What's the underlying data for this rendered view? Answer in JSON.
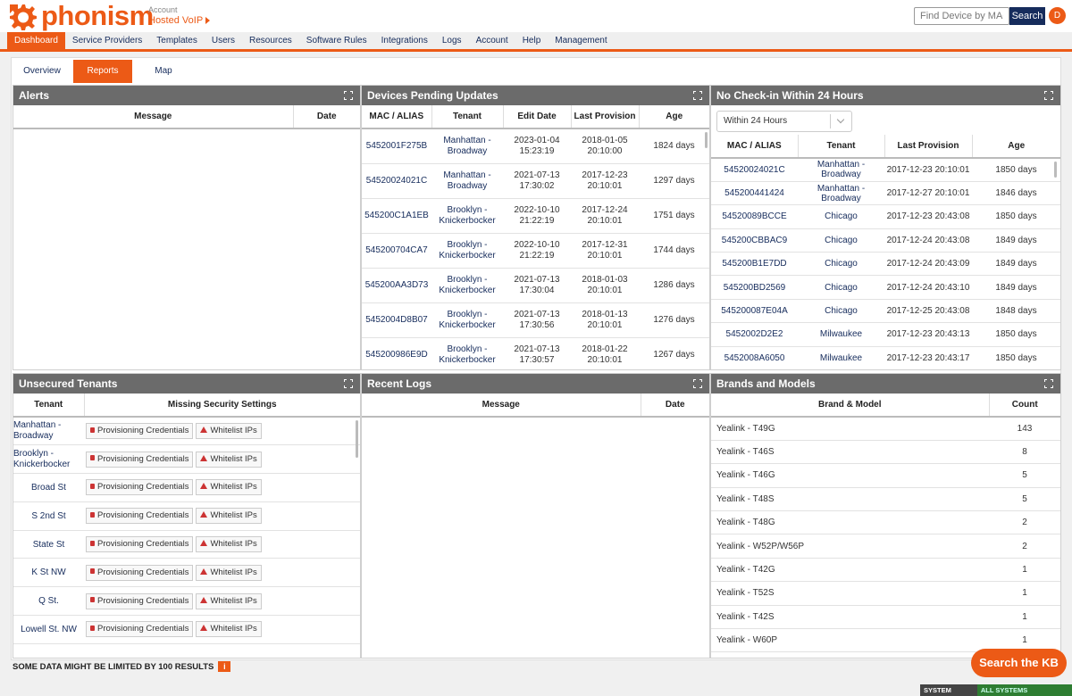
{
  "header": {
    "logo_text": "phonism",
    "account_label": "Account",
    "account_name": "Hosted VoIP",
    "search_placeholder": "Find Device by MAC",
    "search_button": "Search",
    "avatar_initial": "D",
    "brand_color": "#ec5a16",
    "navy_color": "#162c5c"
  },
  "nav": [
    {
      "label": "Dashboard",
      "active": true
    },
    {
      "label": "Service Providers"
    },
    {
      "label": "Templates"
    },
    {
      "label": "Users"
    },
    {
      "label": "Resources"
    },
    {
      "label": "Software Rules"
    },
    {
      "label": "Integrations"
    },
    {
      "label": "Logs"
    },
    {
      "label": "Account"
    },
    {
      "label": "Help"
    },
    {
      "label": "Management"
    }
  ],
  "subtabs": [
    {
      "label": "Overview"
    },
    {
      "label": "Reports",
      "active": true
    },
    {
      "label": "Map"
    }
  ],
  "alerts": {
    "title": "Alerts",
    "columns": [
      "Message",
      "Date"
    ]
  },
  "devices_pending": {
    "title": "Devices Pending Updates",
    "columns": [
      "MAC / ALIAS",
      "Tenant",
      "Edit Date",
      "Last Provision",
      "Age"
    ],
    "rows": [
      {
        "mac": "5452001F275B",
        "tenant1": "Manhattan -",
        "tenant2": "Broadway",
        "edit1": "2023-01-04",
        "edit2": "15:23:19",
        "prov1": "2018-01-05",
        "prov2": "20:10:00",
        "age": "1824 days"
      },
      {
        "mac": "54520024021C",
        "tenant1": "Manhattan -",
        "tenant2": "Broadway",
        "edit1": "2021-07-13",
        "edit2": "17:30:02",
        "prov1": "2017-12-23",
        "prov2": "20:10:01",
        "age": "1297 days"
      },
      {
        "mac": "545200C1A1EB",
        "tenant1": "Brooklyn -",
        "tenant2": "Knickerbocker",
        "edit1": "2022-10-10",
        "edit2": "21:22:19",
        "prov1": "2017-12-24",
        "prov2": "20:10:01",
        "age": "1751 days"
      },
      {
        "mac": "545200704CA7",
        "tenant1": "Brooklyn -",
        "tenant2": "Knickerbocker",
        "edit1": "2022-10-10",
        "edit2": "21:22:19",
        "prov1": "2017-12-31",
        "prov2": "20:10:01",
        "age": "1744 days"
      },
      {
        "mac": "545200AA3D73",
        "tenant1": "Brooklyn -",
        "tenant2": "Knickerbocker",
        "edit1": "2021-07-13",
        "edit2": "17:30:04",
        "prov1": "2018-01-03",
        "prov2": "20:10:01",
        "age": "1286 days"
      },
      {
        "mac": "5452004D8B07",
        "tenant1": "Brooklyn -",
        "tenant2": "Knickerbocker",
        "edit1": "2021-07-13",
        "edit2": "17:30:56",
        "prov1": "2018-01-13",
        "prov2": "20:10:01",
        "age": "1276 days"
      },
      {
        "mac": "545200986E9D",
        "tenant1": "Brooklyn -",
        "tenant2": "Knickerbocker",
        "edit1": "2021-07-13",
        "edit2": "17:30:57",
        "prov1": "2018-01-22",
        "prov2": "20:10:01",
        "age": "1267 days"
      }
    ]
  },
  "no_checkin": {
    "title": "No Check-in Within 24 Hours",
    "filter_value": "Within 24 Hours",
    "columns": [
      "MAC / ALIAS",
      "Tenant",
      "Last Provision",
      "Age"
    ],
    "rows": [
      {
        "mac": "54520024021C",
        "tenant": "Manhattan - Broadway",
        "prov": "2017-12-23 20:10:01",
        "age": "1850 days"
      },
      {
        "mac": "545200441424",
        "tenant": "Manhattan - Broadway",
        "prov": "2017-12-27 20:10:01",
        "age": "1846 days"
      },
      {
        "mac": "54520089BCCE",
        "tenant": "Chicago",
        "prov": "2017-12-23 20:43:08",
        "age": "1850 days"
      },
      {
        "mac": "545200CBBAC9",
        "tenant": "Chicago",
        "prov": "2017-12-24 20:43:08",
        "age": "1849 days"
      },
      {
        "mac": "545200B1E7DD",
        "tenant": "Chicago",
        "prov": "2017-12-24 20:43:09",
        "age": "1849 days"
      },
      {
        "mac": "545200BD2569",
        "tenant": "Chicago",
        "prov": "2017-12-24 20:43:10",
        "age": "1849 days"
      },
      {
        "mac": "545200087E04A",
        "tenant": "Chicago",
        "prov": "2017-12-25 20:43:08",
        "age": "1848 days"
      },
      {
        "mac": "5452002D2E2",
        "tenant": "Milwaukee",
        "prov": "2017-12-23 20:43:13",
        "age": "1850 days"
      },
      {
        "mac": "5452008A6050",
        "tenant": "Milwaukee",
        "prov": "2017-12-23 20:43:17",
        "age": "1850 days"
      }
    ]
  },
  "unsecured": {
    "title": "Unsecured Tenants",
    "columns": [
      "Tenant",
      "Missing Security Settings"
    ],
    "badge_creds": "Provisioning Credentials",
    "badge_whitelist": "Whitelist IPs",
    "rows": [
      {
        "line1": "Manhattan -",
        "line2": "Broadway"
      },
      {
        "line1": "Brooklyn -",
        "line2": "Knickerbocker"
      },
      {
        "line1": "Broad St"
      },
      {
        "line1": "S 2nd St"
      },
      {
        "line1": "State St"
      },
      {
        "line1": "K St NW"
      },
      {
        "line1": "Q St."
      },
      {
        "line1": "Lowell St. NW"
      }
    ]
  },
  "recent_logs": {
    "title": "Recent Logs",
    "columns": [
      "Message",
      "Date"
    ]
  },
  "brands": {
    "title": "Brands and Models",
    "columns": [
      "Brand & Model",
      "Count"
    ],
    "rows": [
      {
        "model": "Yealink - T49G",
        "count": "143"
      },
      {
        "model": "Yealink - T46S",
        "count": "8"
      },
      {
        "model": "Yealink - T46G",
        "count": "5"
      },
      {
        "model": "Yealink - T48S",
        "count": "5"
      },
      {
        "model": "Yealink - T48G",
        "count": "2"
      },
      {
        "model": "Yealink - W52P/W56P",
        "count": "2"
      },
      {
        "model": "Yealink - T42G",
        "count": "1"
      },
      {
        "model": "Yealink - T52S",
        "count": "1"
      },
      {
        "model": "Yealink - T42S",
        "count": "1"
      },
      {
        "model": "Yealink - W60P",
        "count": "1"
      }
    ]
  },
  "footer": {
    "limit_note": "SOME DATA MIGHT BE LIMITED BY 100 RESULTS",
    "info_glyph": "i",
    "kb_button": "Search the KB",
    "status_label": "SYSTEM STATUS",
    "status_value": "ALL SYSTEMS OPERATIONAL"
  }
}
